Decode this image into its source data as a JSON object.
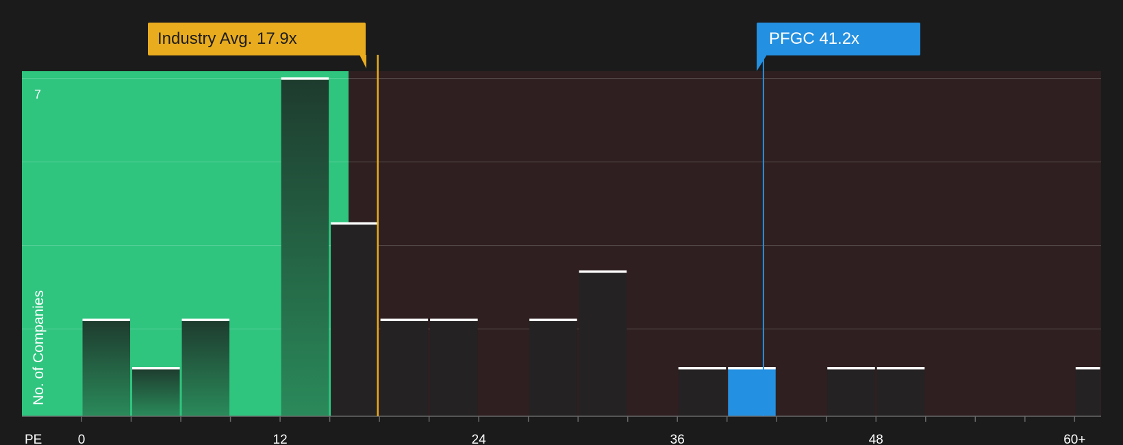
{
  "chart_data": {
    "type": "bar",
    "title": "",
    "xlabel": "PE",
    "ylabel": "No. of Companies",
    "xlim": [
      -3.6,
      61.6
    ],
    "ylim": [
      0,
      7.15
    ],
    "x_ticks": [
      0,
      12,
      24,
      36,
      48,
      60
    ],
    "x_tick_labels": [
      "0",
      "12",
      "24",
      "36",
      "48",
      "60+"
    ],
    "y_tick_labels": [
      "7"
    ],
    "grid": true,
    "bins": [
      {
        "x": [
          0,
          3
        ],
        "value": 2
      },
      {
        "x": [
          3,
          6
        ],
        "value": 1
      },
      {
        "x": [
          6,
          9
        ],
        "value": 2
      },
      {
        "x": [
          12,
          15
        ],
        "value": 7
      },
      {
        "x": [
          15,
          18
        ],
        "value": 4
      },
      {
        "x": [
          18,
          21
        ],
        "value": 2
      },
      {
        "x": [
          21,
          24
        ],
        "value": 2
      },
      {
        "x": [
          27,
          30
        ],
        "value": 2
      },
      {
        "x": [
          30,
          33
        ],
        "value": 3
      },
      {
        "x": [
          36,
          39
        ],
        "value": 1
      },
      {
        "x": [
          39,
          42
        ],
        "value": 1,
        "highlight": true
      },
      {
        "x": [
          45,
          48
        ],
        "value": 1
      },
      {
        "x": [
          48,
          51
        ],
        "value": 1
      },
      {
        "x": [
          60,
          61.6
        ],
        "value": 1
      }
    ],
    "industry_avg": {
      "label": "Industry Avg. 17.9x",
      "value": 17.9
    },
    "company": {
      "label": "PFGC 41.2x",
      "value": 41.2
    },
    "colors": {
      "background": "#1b1b1b",
      "good_region": "#2fc57f",
      "bad_region": "#2f1f20",
      "industry": "#e9ac1e",
      "company": "#2490e1",
      "bar_in_good": "#1f4a36",
      "bar_in_bad": "#242222",
      "cap": "#ffffff",
      "grid": "#4a3a3b",
      "text": "#ffffff"
    }
  }
}
